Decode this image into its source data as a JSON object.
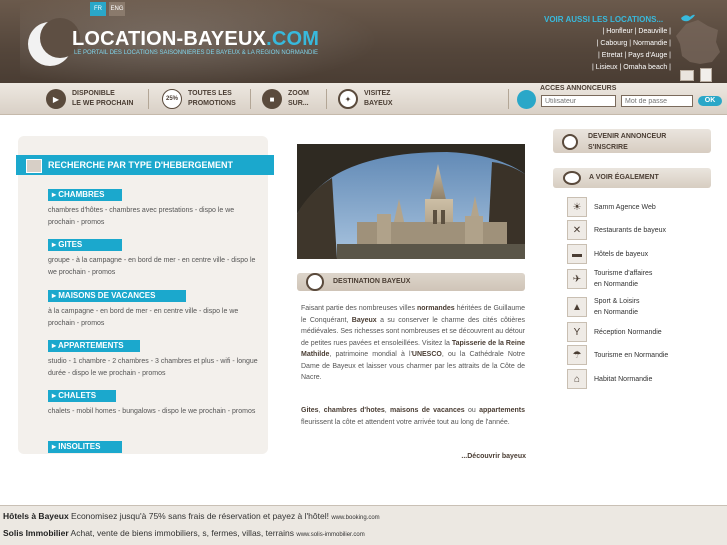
{
  "header": {
    "lang_fr": "FR",
    "lang_en": "ENG",
    "logo_main": "LOCATION-BAYEUX",
    "logo_dot": ".COM",
    "tagline": "LE PORTAIL DES LOCATIONS SAISONNIERES DE BAYEUX & LA REGION NORMANDIE",
    "aussi_title": "VOIR AUSSI LES LOCATIONS...",
    "aussi_lines": [
      "| Honfleur | Deauville |",
      "| Cabourg | Normandie |",
      "| Etretat | Pays d'Auge |",
      "| Lisieux | Omaha beach |"
    ],
    "colors": {
      "accent": "#38b9dc",
      "header_bg": "#5e4f43"
    }
  },
  "nav": {
    "items": [
      {
        "label": "DISPONIBLE\nLE WE PROCHAIN",
        "icon": "arrow-right-icon"
      },
      {
        "label": "TOUTES LES\nPROMOTIONS",
        "icon": "percent-badge-icon",
        "badge": "25%"
      },
      {
        "label": "ZOOM\nSUR...",
        "icon": "camera-icon"
      },
      {
        "label": "VISITEZ\nBAYEUX",
        "icon": "compass-icon"
      }
    ],
    "acces_title": "ACCES ANNONCEURS",
    "user_placeholder": "Utilisateur",
    "pass_placeholder": "Mot de passe",
    "ok_label": "OK"
  },
  "search": {
    "title": "RECHERCHE PAR TYPE D'HEBERGEMENT",
    "categories": [
      {
        "label": "CHAMBRES",
        "desc": "chambres d'hôtes - chambres avec prestations - dispo le we prochain - promos"
      },
      {
        "label": "GITES",
        "desc": "groupe - à la campagne - en bord de mer - en centre ville - dispo le we prochain - promos"
      },
      {
        "label": "MAISONS DE VACANCES",
        "desc": "à la campagne - en bord de mer - en centre ville - dispo le we prochain - promos"
      },
      {
        "label": "APPARTEMENTS",
        "desc": "studio - 1 chambre - 2 chambres - 3 chambres et plus - wifi - longue durée - dispo le we prochain - promos"
      },
      {
        "label": "CHALETS",
        "desc": "chalets - mobil homes - bungalows - dispo le we prochain - promos"
      },
      {
        "label": "INSOLITES",
        "desc": ""
      }
    ]
  },
  "destination": {
    "title": "DESTINATION BAYEUX",
    "p1_a": "Faisant partie des nombreuses villes ",
    "p1_b": "normandes",
    "p1_c": " héritées de Guillaume le Conquérant, ",
    "p1_d": "Bayeux",
    "p1_e": " a su conserver le charme des cités côtières médiévales. Ses richesses sont nombreuses et se découvrent au détour de petites rues pavées et ensoleillées. Visitez la ",
    "p1_f": "Tapisserie de la Reine Mathilde",
    "p1_g": ", patrimoine mondial à l'",
    "p1_h": "UNESCO",
    "p1_i": ", ou la Cathédrale Notre Dame de Bayeux et laisser vous charmer par les attraits de la Côte de Nacre.",
    "p2_a": "Gites",
    "p2_b": ", ",
    "p2_c": "chambres d'hotes",
    "p2_d": ", ",
    "p2_e": "maisons de vacances",
    "p2_f": " ou ",
    "p2_g": "appartements",
    "p2_h": " fleurissent la côte et attendent votre arrivée tout au long de l'année.",
    "link": "...Découvrir bayeux"
  },
  "sidebar": {
    "annonceur": "DEVENIR ANNONCEUR\nS'INSCRIRE",
    "voir_title": "A VOIR ÉGALEMENT",
    "items": [
      {
        "label": "Samm Agence Web",
        "icon": "sun-icon"
      },
      {
        "label": "Restaurants de bayeux",
        "icon": "cutlery-icon"
      },
      {
        "label": "Hôtels de bayeux",
        "icon": "bed-icon"
      },
      {
        "label": "Tourisme d'affaires\nen Normandie",
        "icon": "plane-icon"
      },
      {
        "label": "Sport & Loisirs\nen Normandie",
        "icon": "sailboat-icon"
      },
      {
        "label": "Réception Normandie",
        "icon": "cocktail-icon"
      },
      {
        "label": "Tourisme en Normandie",
        "icon": "beach-icon"
      },
      {
        "label": "Habitat Normandie",
        "icon": "house-icon"
      }
    ]
  },
  "ads": {
    "line1_title": "Hôtels à Bayeux",
    "line1_text": " Economisez jusqu'à 75% sans frais de réservation et payez à l'hôtel! ",
    "line1_url": "www.booking.com",
    "line2_title": "Solis Immobilier",
    "line2_text": " Achat, vente de biens immobiliers, s, fermes, villas, terrains ",
    "line2_url": "www.solis-immobilier.com"
  }
}
